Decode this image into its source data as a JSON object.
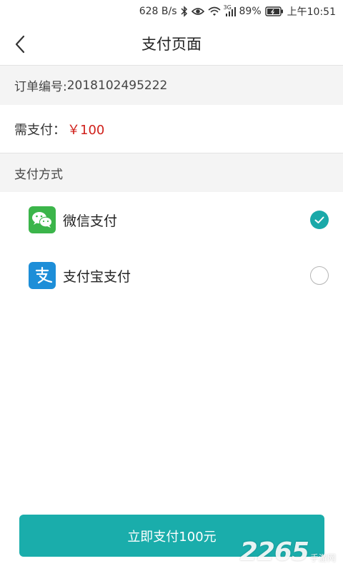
{
  "status_bar": {
    "speed": "628 B/s",
    "network": "3G",
    "battery": "89%",
    "time": "上午10:51",
    "icons": [
      "bluetooth-icon",
      "eye-icon",
      "wifi-icon",
      "signal-icon",
      "battery-icon"
    ]
  },
  "header": {
    "title": "支付页面",
    "back_icon": "chevron-left-icon"
  },
  "order": {
    "label": "订单编号:",
    "number": "2018102495222"
  },
  "amount": {
    "label": "需支付：",
    "value": "￥100",
    "value_color": "#d0211c"
  },
  "payment": {
    "section_label": "支付方式",
    "methods": [
      {
        "label": "微信支付",
        "icon": "wechat-icon",
        "selected": true
      },
      {
        "label": "支付宝支付",
        "icon": "alipay-icon",
        "selected": false
      }
    ]
  },
  "pay_button": {
    "label": "立即支付100元",
    "color": "#1aadab"
  },
  "watermark": {
    "number": "2265",
    "text": "手游网"
  }
}
